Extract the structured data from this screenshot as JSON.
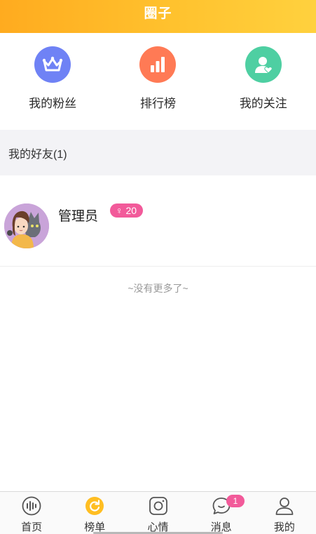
{
  "header": {
    "title": "圈子"
  },
  "quick_actions": [
    {
      "label": "我的粉丝",
      "icon": "crown-icon",
      "color": "#6f82f5"
    },
    {
      "label": "排行榜",
      "icon": "bar-chart-icon",
      "color": "#ff7a55"
    },
    {
      "label": "我的关注",
      "icon": "user-heart-icon",
      "color": "#4ecfa2"
    }
  ],
  "friends_section": {
    "title": "我的好友(1)"
  },
  "friends": [
    {
      "name": "管理员",
      "gender_symbol": "♀",
      "level": "20",
      "avatar": "girl-with-cat-avatar"
    }
  ],
  "list_end": {
    "text": "~没有更多了~"
  },
  "tabbar": [
    {
      "label": "首页",
      "icon": "soundwave-icon"
    },
    {
      "label": "榜单",
      "icon": "refresh-circle-icon",
      "active": true
    },
    {
      "label": "心情",
      "icon": "camera-icon"
    },
    {
      "label": "消息",
      "icon": "chat-bubble-icon",
      "badge": "1"
    },
    {
      "label": "我的",
      "icon": "person-icon"
    }
  ],
  "colors": {
    "header_start": "#ffab1f",
    "header_end": "#ffd13e",
    "accent_pink": "#f25a9a",
    "section_bg": "#f3f3f6"
  }
}
